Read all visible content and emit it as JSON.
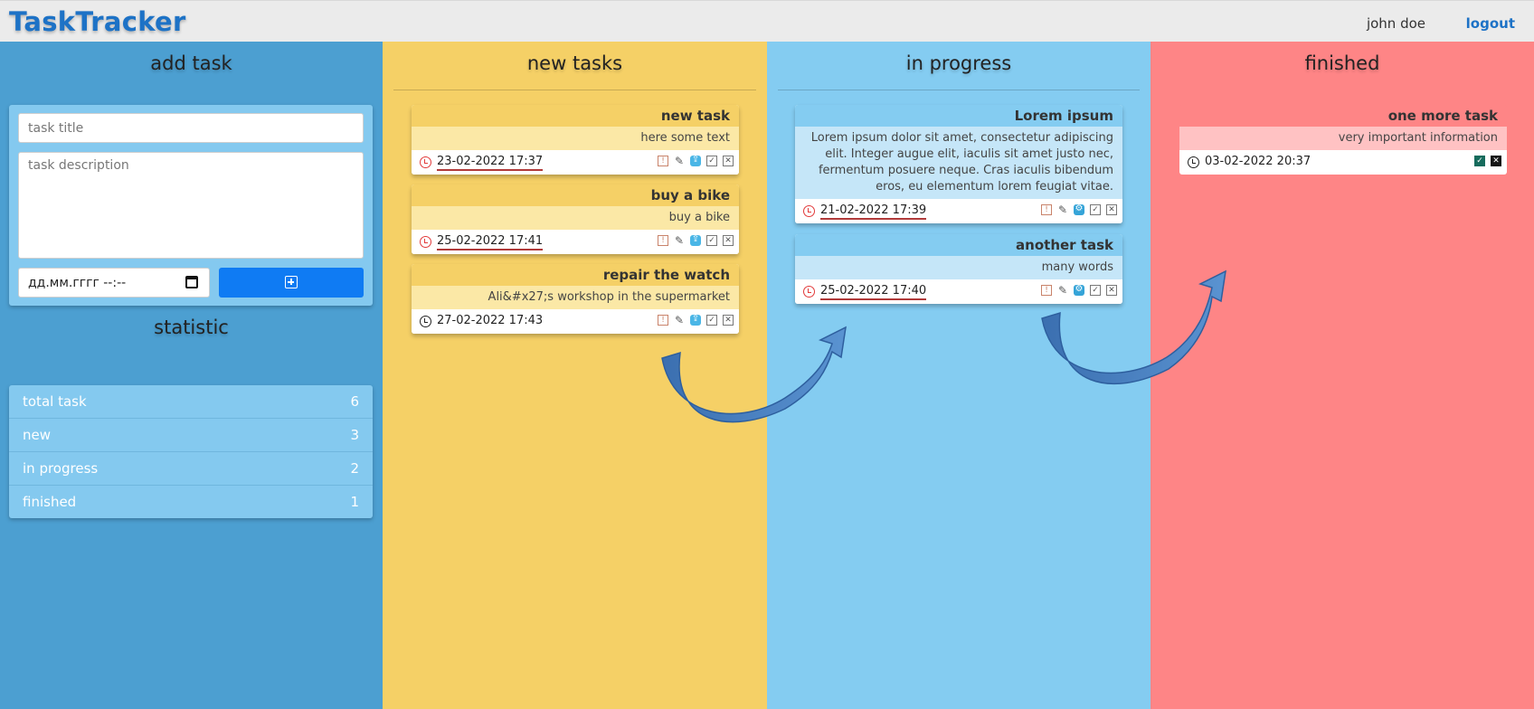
{
  "app": {
    "brand": "TaskTracker"
  },
  "header": {
    "user": "john doe",
    "logout_label": "logout"
  },
  "add_task": {
    "title": "add task",
    "title_placeholder": "task title",
    "desc_placeholder": "task description",
    "date_placeholder": "дд.мм.гггг --:--"
  },
  "statistic": {
    "title": "statistic",
    "rows": [
      {
        "label": "total task",
        "value": "6"
      },
      {
        "label": "new",
        "value": "3"
      },
      {
        "label": "in progress",
        "value": "2"
      },
      {
        "label": "finished",
        "value": "1"
      }
    ]
  },
  "columns": {
    "new": {
      "title": "new tasks",
      "tasks": [
        {
          "title": "new task",
          "desc": "here some text",
          "date": "23-02-2022 17:37"
        },
        {
          "title": "buy a bike",
          "desc": "buy a bike",
          "date": "25-02-2022 17:41"
        },
        {
          "title": "repair the watch",
          "desc": "Ali&#x27;s workshop in the supermarket",
          "date": "27-02-2022 17:43"
        }
      ]
    },
    "progress": {
      "title": "in progress",
      "tasks": [
        {
          "title": "Lorem ipsum",
          "desc": "Lorem ipsum dolor sit amet, consectetur adipiscing elit. Integer augue elit, iaculis sit amet justo nec, fermentum posuere neque. Cras iaculis bibendum eros, eu elementum lorem feugiat vitae.",
          "date": "21-02-2022 17:39"
        },
        {
          "title": "another task",
          "desc": "many words",
          "date": "25-02-2022 17:40"
        }
      ]
    },
    "finished": {
      "title": "finished",
      "tasks": [
        {
          "title": "one more task",
          "desc": "very important information",
          "date": "03-02-2022 20:37"
        }
      ]
    }
  },
  "colors": {
    "add_column": "#4c9fd1",
    "new_column": "#f5d066",
    "progress_column": "#84ccf1",
    "finished_column": "#fe8586",
    "brand": "#1d72c6",
    "add_button": "#0f7bf3"
  }
}
